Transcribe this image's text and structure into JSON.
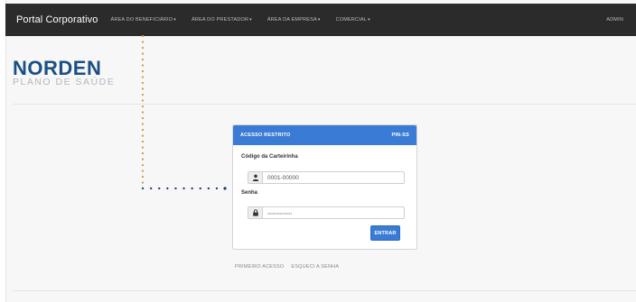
{
  "navbar": {
    "brand": "Portal Corporativo",
    "items": [
      {
        "label": "ÁREA DO BENEFICIÁRIO"
      },
      {
        "label": "ÁREA DO PRESTADOR"
      },
      {
        "label": "ÁREA DA EMPRESA"
      },
      {
        "label": "COMERCIAL"
      }
    ],
    "admin": "ADMIN"
  },
  "logo": {
    "main": "NORDEN",
    "sub": "PLANO DE SAÚDE"
  },
  "login": {
    "header_title": "ACESSO RESTRITO",
    "header_code": "PIN-SS",
    "card_label": "Código da Carteirinha",
    "card_value": "0001-00000",
    "password_label": "Senha",
    "password_value": "••••••••••••••••",
    "submit": "ENTRAR"
  },
  "links": {
    "first_access": "PRIMEIRO ACESSO",
    "forgot": "ESQUECI A SENHA"
  },
  "colors": {
    "navbar": "#2b2b2b",
    "accent": "#3a7bd5",
    "logo": "#1a4f87",
    "callout": "#c8a24a"
  },
  "icons": [
    "caret-down-icon",
    "user-icon",
    "lock-icon"
  ]
}
